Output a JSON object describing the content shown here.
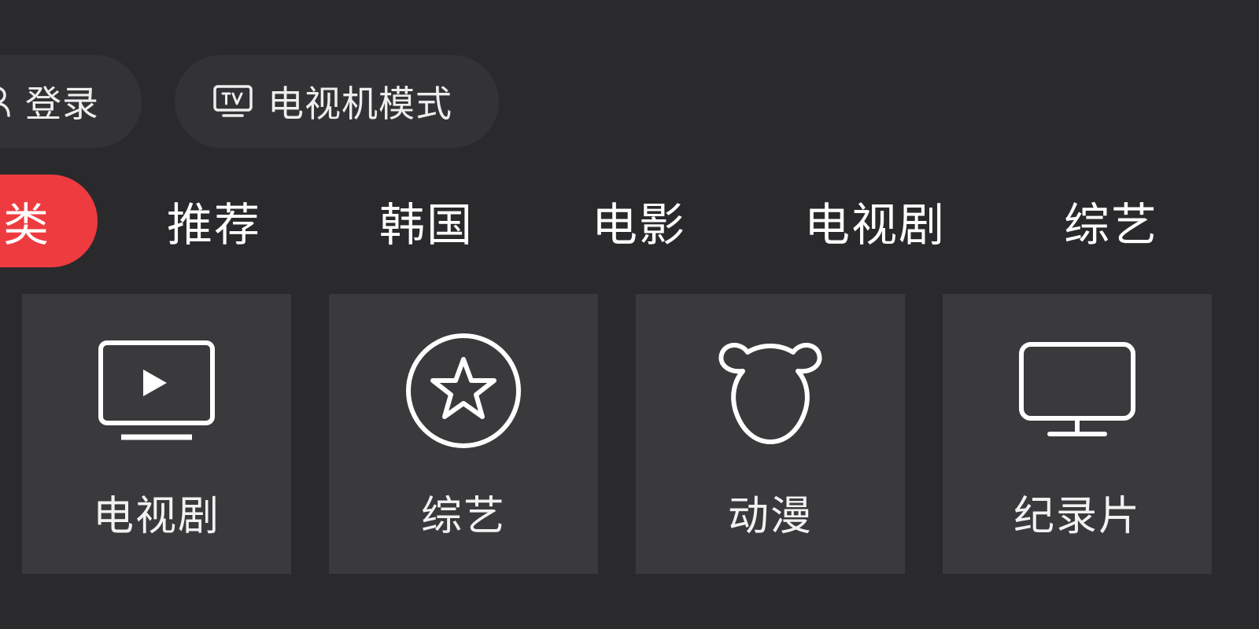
{
  "header": {
    "login_label": "登录",
    "tv_mode_label": "电视机模式"
  },
  "tabs": {
    "active_label": "类",
    "items": [
      {
        "label": "推荐"
      },
      {
        "label": "韩国"
      },
      {
        "label": "电影"
      },
      {
        "label": "电视剧"
      },
      {
        "label": "综艺"
      }
    ]
  },
  "cards": [
    {
      "label": "电视剧",
      "icon": "tv-play-icon"
    },
    {
      "label": "综艺",
      "icon": "star-circle-icon"
    },
    {
      "label": "动漫",
      "icon": "bear-icon"
    },
    {
      "label": "纪录片",
      "icon": "monitor-icon"
    }
  ],
  "colors": {
    "background": "#2a2a2c",
    "pill_background": "#333336",
    "card_background": "#3a393c",
    "accent": "#ee3b40",
    "text": "#ffffff"
  }
}
